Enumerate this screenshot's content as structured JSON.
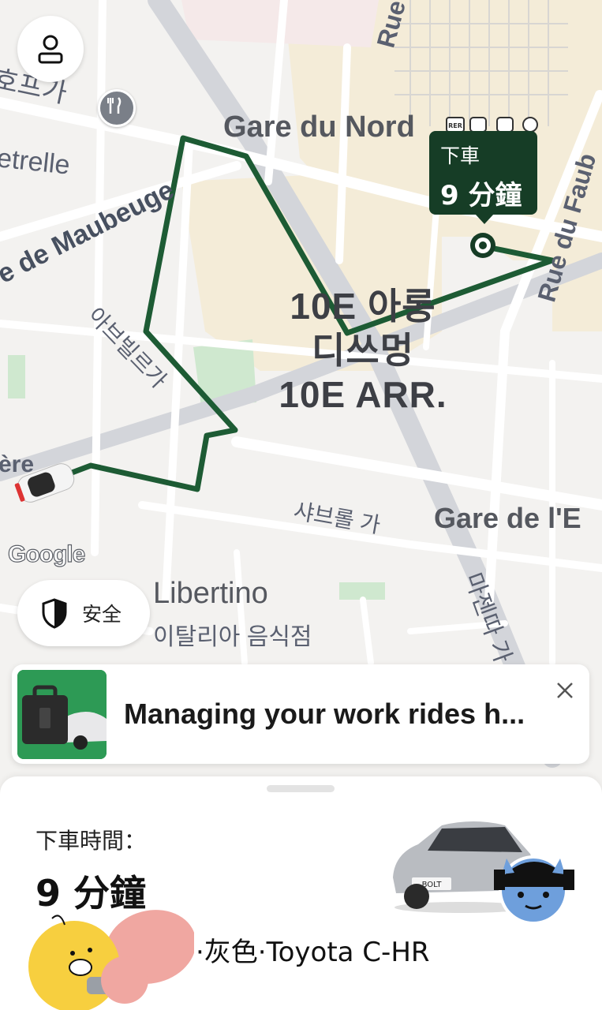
{
  "map": {
    "streets": {
      "top_left_kr": "호프가",
      "petrelle": "etrelle",
      "maubeuge": "e de Maubeuge",
      "maubeuge_kr": "아브빌르가",
      "rue_fr": "Rue",
      "faubourg": "Rue du Faub",
      "lafayette_end": "ère",
      "chabrol_kr": "샤브롤 가",
      "magenta_kr": "마젠따 가"
    },
    "stations": {
      "gare_du_nord": "Gare du Nord",
      "gare_de_lest": "Gare de l'E",
      "rer_badge": "RER"
    },
    "district": {
      "line1": "10E 아롱",
      "line2": "디쓰멍",
      "line3": "10E ARR."
    },
    "poi": {
      "name": "Libertino",
      "subtitle": "이탈리아 음식점"
    },
    "route_color": "#1d5b34",
    "google_logo": "Google"
  },
  "dropoff_tooltip": {
    "label": "下車",
    "eta": "9 分鐘"
  },
  "safety_button": {
    "label": "安全"
  },
  "promo_banner": {
    "text": "Managing your work rides h..."
  },
  "trip_sheet": {
    "label": "下車時間：",
    "eta": "9 分鐘",
    "vehicle_info": "·灰色·Toyota C-HR",
    "plate": "BOLT"
  }
}
